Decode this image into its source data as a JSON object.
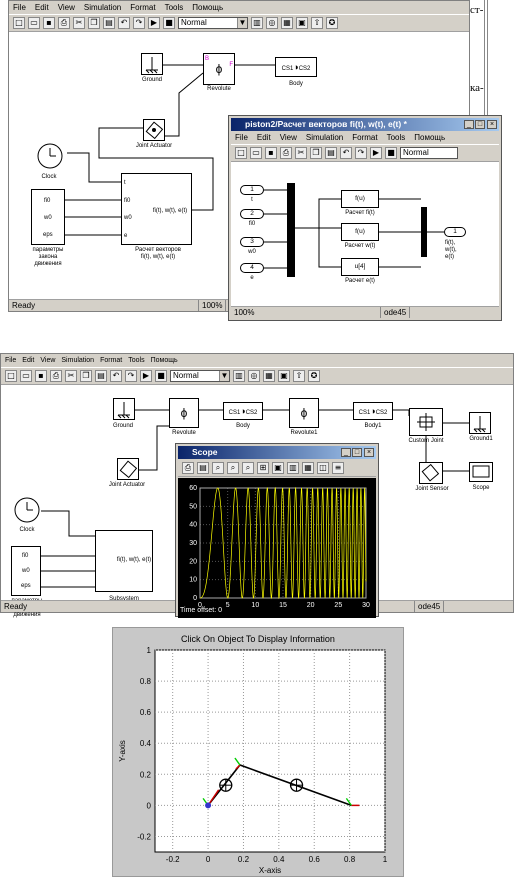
{
  "win1": {
    "menu": [
      "File",
      "Edit",
      "View",
      "Simulation",
      "Format",
      "Tools",
      "Помощь"
    ],
    "mode": "Normal",
    "status": "Ready",
    "zoom": "100%",
    "blocks": {
      "ground": "Ground",
      "revolute": "Revolute",
      "body": "Body",
      "actuator": "Joint Actuator",
      "clock": "Clock",
      "params": "параметры\nзакона\nдвижения",
      "calc": "Расчет векторов\nfi(t), w(t), e(t)",
      "calc_out": "fi(t), w(t), e(t)",
      "in_t": "t",
      "in_fi0": "fi0",
      "in_w0": "w0",
      "in_eps": "eps",
      "in_e": "e",
      "p_fi0": "fi0",
      "p_w0": "w0",
      "p_eps": "eps",
      "cs1": "CS1",
      "cs2": "CS2",
      "b": "B",
      "f": "F"
    }
  },
  "side": {
    "t1": "ст-",
    "t2": "ка-"
  },
  "win2": {
    "title": "piston2/Расчет векторов fi(t), w(t), e(t) *",
    "menu": [
      "File",
      "Edit",
      "View",
      "Simulation",
      "Format",
      "Tools",
      "Помощь"
    ],
    "mode": "Normal",
    "zoom": "100%",
    "solver": "ode45",
    "blocks": {
      "in1": "1",
      "in1l": "t",
      "in2": "2",
      "in2l": "fi0",
      "in3": "3",
      "in3l": "w0",
      "in4": "4",
      "in4l": "e",
      "fn1": "f(u)",
      "fn1l": "Расчет fi(t)",
      "fn2": "f(u)",
      "fn2l": "Расчет w(t)",
      "fn3": "u[4]",
      "fn3l": "Расчет e(t)",
      "out1": "1",
      "out1l": "fi(t),\nw(t),\ne(t)"
    }
  },
  "win3": {
    "menu": [
      "File",
      "Edit",
      "View",
      "Simulation",
      "Format",
      "Tools",
      "Помощь"
    ],
    "mode": "Normal",
    "status": "Ready",
    "solver": "ode45",
    "blocks": {
      "ground": "Ground",
      "revolute": "Revolute",
      "body": "Body",
      "revolute1": "Revolute1",
      "body1": "Body1",
      "custom": "Custom Joint",
      "ground1": "Ground1",
      "actuator": "Joint Actuator",
      "sensor": "Joint Sensor",
      "scope": "Scope",
      "clock": "Clock",
      "subsystem": "Subsystem",
      "params": "параметры\nзакона\nдвижения",
      "sub_out": "fi(t), w(t), e(t)",
      "p_fi0": "fi0",
      "p_w0": "w0",
      "p_eps": "eps",
      "cs1": "CS1",
      "cs2": "CS2"
    }
  },
  "scope": {
    "title": "Scope",
    "time_offset": "Time offset:  0",
    "x_ticks": [
      "0",
      "5",
      "10",
      "15",
      "20",
      "25",
      "30"
    ],
    "y_ticks": [
      "0",
      "10",
      "20",
      "30",
      "40",
      "50",
      "60"
    ]
  },
  "plot3": {
    "title": "Click On Object To Display Information",
    "xlabel": "X-axis",
    "ylabel": "Y-axis",
    "x_ticks": [
      "-0.2",
      "0",
      "0.2",
      "0.4",
      "0.6",
      "0.8",
      "1"
    ],
    "y_ticks": [
      "-0.2",
      "0",
      "0.2",
      "0.4",
      "0.6",
      "0.8",
      "1"
    ],
    "links": [
      [
        0,
        0
      ],
      [
        0.18,
        0.26
      ],
      [
        0.81,
        0
      ]
    ],
    "joints": [
      [
        0.1,
        0.13
      ],
      [
        0.5,
        0.13
      ]
    ]
  }
}
